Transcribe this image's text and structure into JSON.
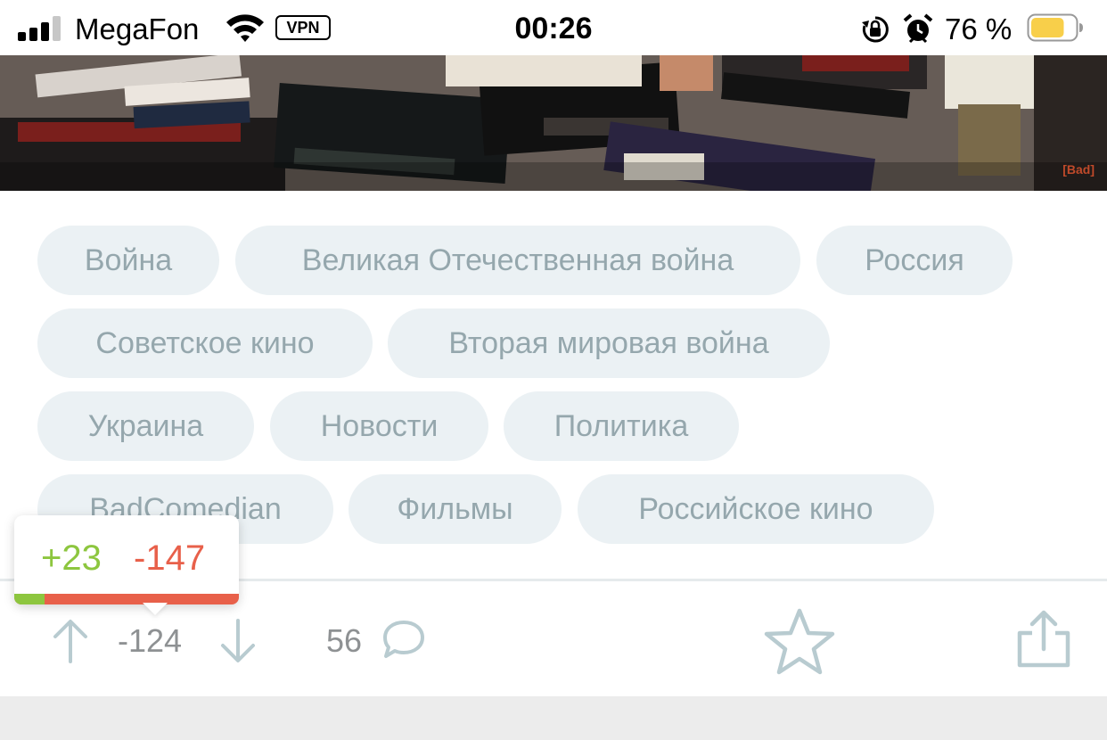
{
  "status_bar": {
    "carrier": "MegaFon",
    "vpn_label": "VPN",
    "time": "00:26",
    "battery_percent": "76 %",
    "battery_level": 0.76,
    "battery_color": "#f8cf4a",
    "icons": [
      "signal-icon",
      "wifi-icon",
      "rotation-lock-icon",
      "alarm-icon",
      "battery-icon"
    ]
  },
  "hero": {
    "watermark": "[Bad]"
  },
  "tags": [
    "Война",
    "Великая Отечественная война",
    "Россия",
    "Советское кино",
    "Вторая мировая война",
    "Украина",
    "Новости",
    "Политика",
    "BadComedian",
    "Фильмы",
    "Российское кино"
  ],
  "vote_popover": {
    "plus": "+23",
    "minus": "-147",
    "plus_fraction": 0.135,
    "plus_color": "#8dc63f",
    "minus_color": "#e8604a"
  },
  "actions": {
    "rating": "-124",
    "comments_count": "56",
    "icons": [
      "arrow-up-icon",
      "arrow-down-icon",
      "comment-icon",
      "star-icon",
      "share-icon"
    ]
  }
}
